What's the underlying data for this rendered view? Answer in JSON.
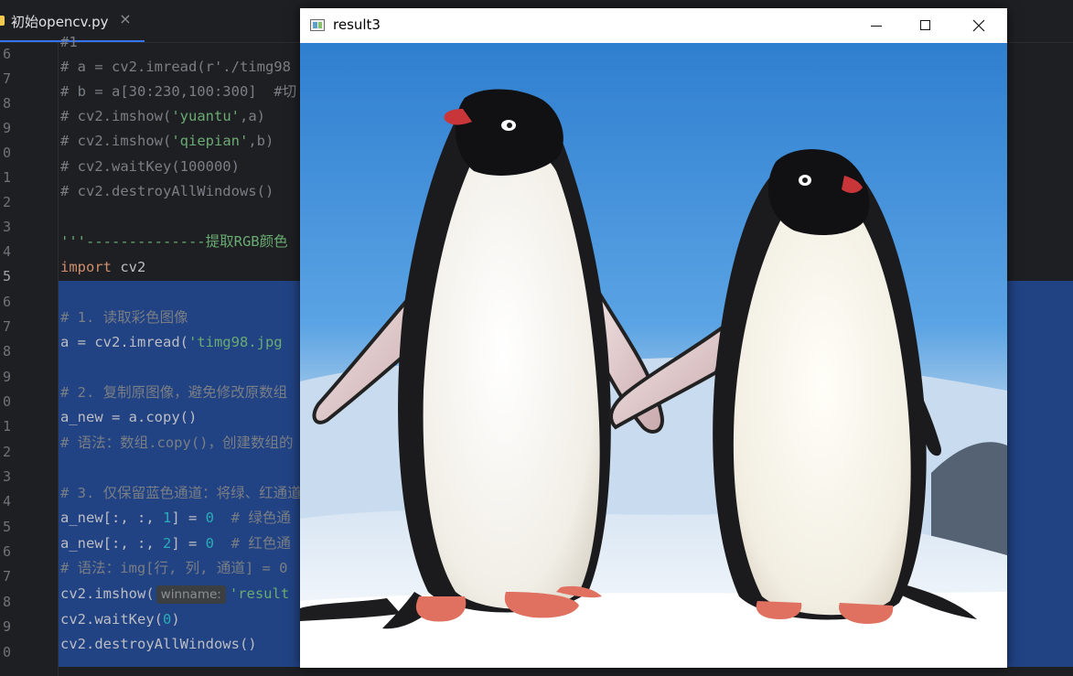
{
  "editor_tab": {
    "label": "初始opencv.py",
    "close_glyph": "×"
  },
  "gutter": {
    "line_numbers": [
      "6",
      "7",
      "8",
      "9",
      "0",
      "1",
      "2",
      "3",
      "4",
      "5",
      "6",
      "7",
      "8",
      "9",
      "0",
      "1",
      "2",
      "3",
      "4",
      "5",
      "6",
      "7",
      "8",
      "9",
      "0"
    ],
    "current_line": "5"
  },
  "code": {
    "l1": "# a = cv2.imread(r'./timg98",
    "l2": "# b = a[30:230,100:300]  #切",
    "l3_pre": "# cv2.imshow(",
    "l3_str": "'yuantu'",
    "l3_post": ",a)",
    "l4_pre": "# cv2.imshow(",
    "l4_str": "'qiepian'",
    "l4_post": ",b)",
    "l5": "# cv2.waitKey(100000)",
    "l6": "# cv2.destroyAllWindows()",
    "l8": "'''--------------提取RGB颜色",
    "l9_kw": "import",
    "l9_rest": " cv2",
    "l11": "# 1. 读取彩色图像",
    "l12_pre": "a = cv2.imread(",
    "l12_str": "'timg98.jpg",
    "l14": "# 2. 复制原图像，避免修改原数组",
    "l15": "a_new = a.copy()",
    "l16": "# 语法：数组.copy()，创建数组的",
    "l18": "# 3. 仅保留蓝色通道：将绿、红通道",
    "l19_pre": "a_new[:, :, ",
    "l19_idx": "1",
    "l19_mid": "] = ",
    "l19_val": "0",
    "l19_comment": "  # 绿色通",
    "l20_pre": "a_new[:, :, ",
    "l20_idx": "2",
    "l20_mid": "] = ",
    "l20_val": "0",
    "l20_comment": "  # 红色通",
    "l21": "# 语法：img[行, 列, 通道] = 0",
    "l22_pre": "cv2.imshow(",
    "l22_hint": "winname:",
    "l22_str": "'result",
    "l23_pre": "cv2.waitKey(",
    "l23_val": "0",
    "l23_post": ")",
    "l24": "cv2.destroyAllWindows()"
  },
  "cv_window": {
    "title": "result3",
    "controls": [
      "minimize-button",
      "maximize-button",
      "close-button"
    ]
  },
  "colors": {
    "editor_bg": "#1e1f22",
    "selection": "#214283",
    "comment": "#7a7e85",
    "string": "#6aab73",
    "keyword": "#cf8e6d",
    "number": "#2aacb8"
  }
}
